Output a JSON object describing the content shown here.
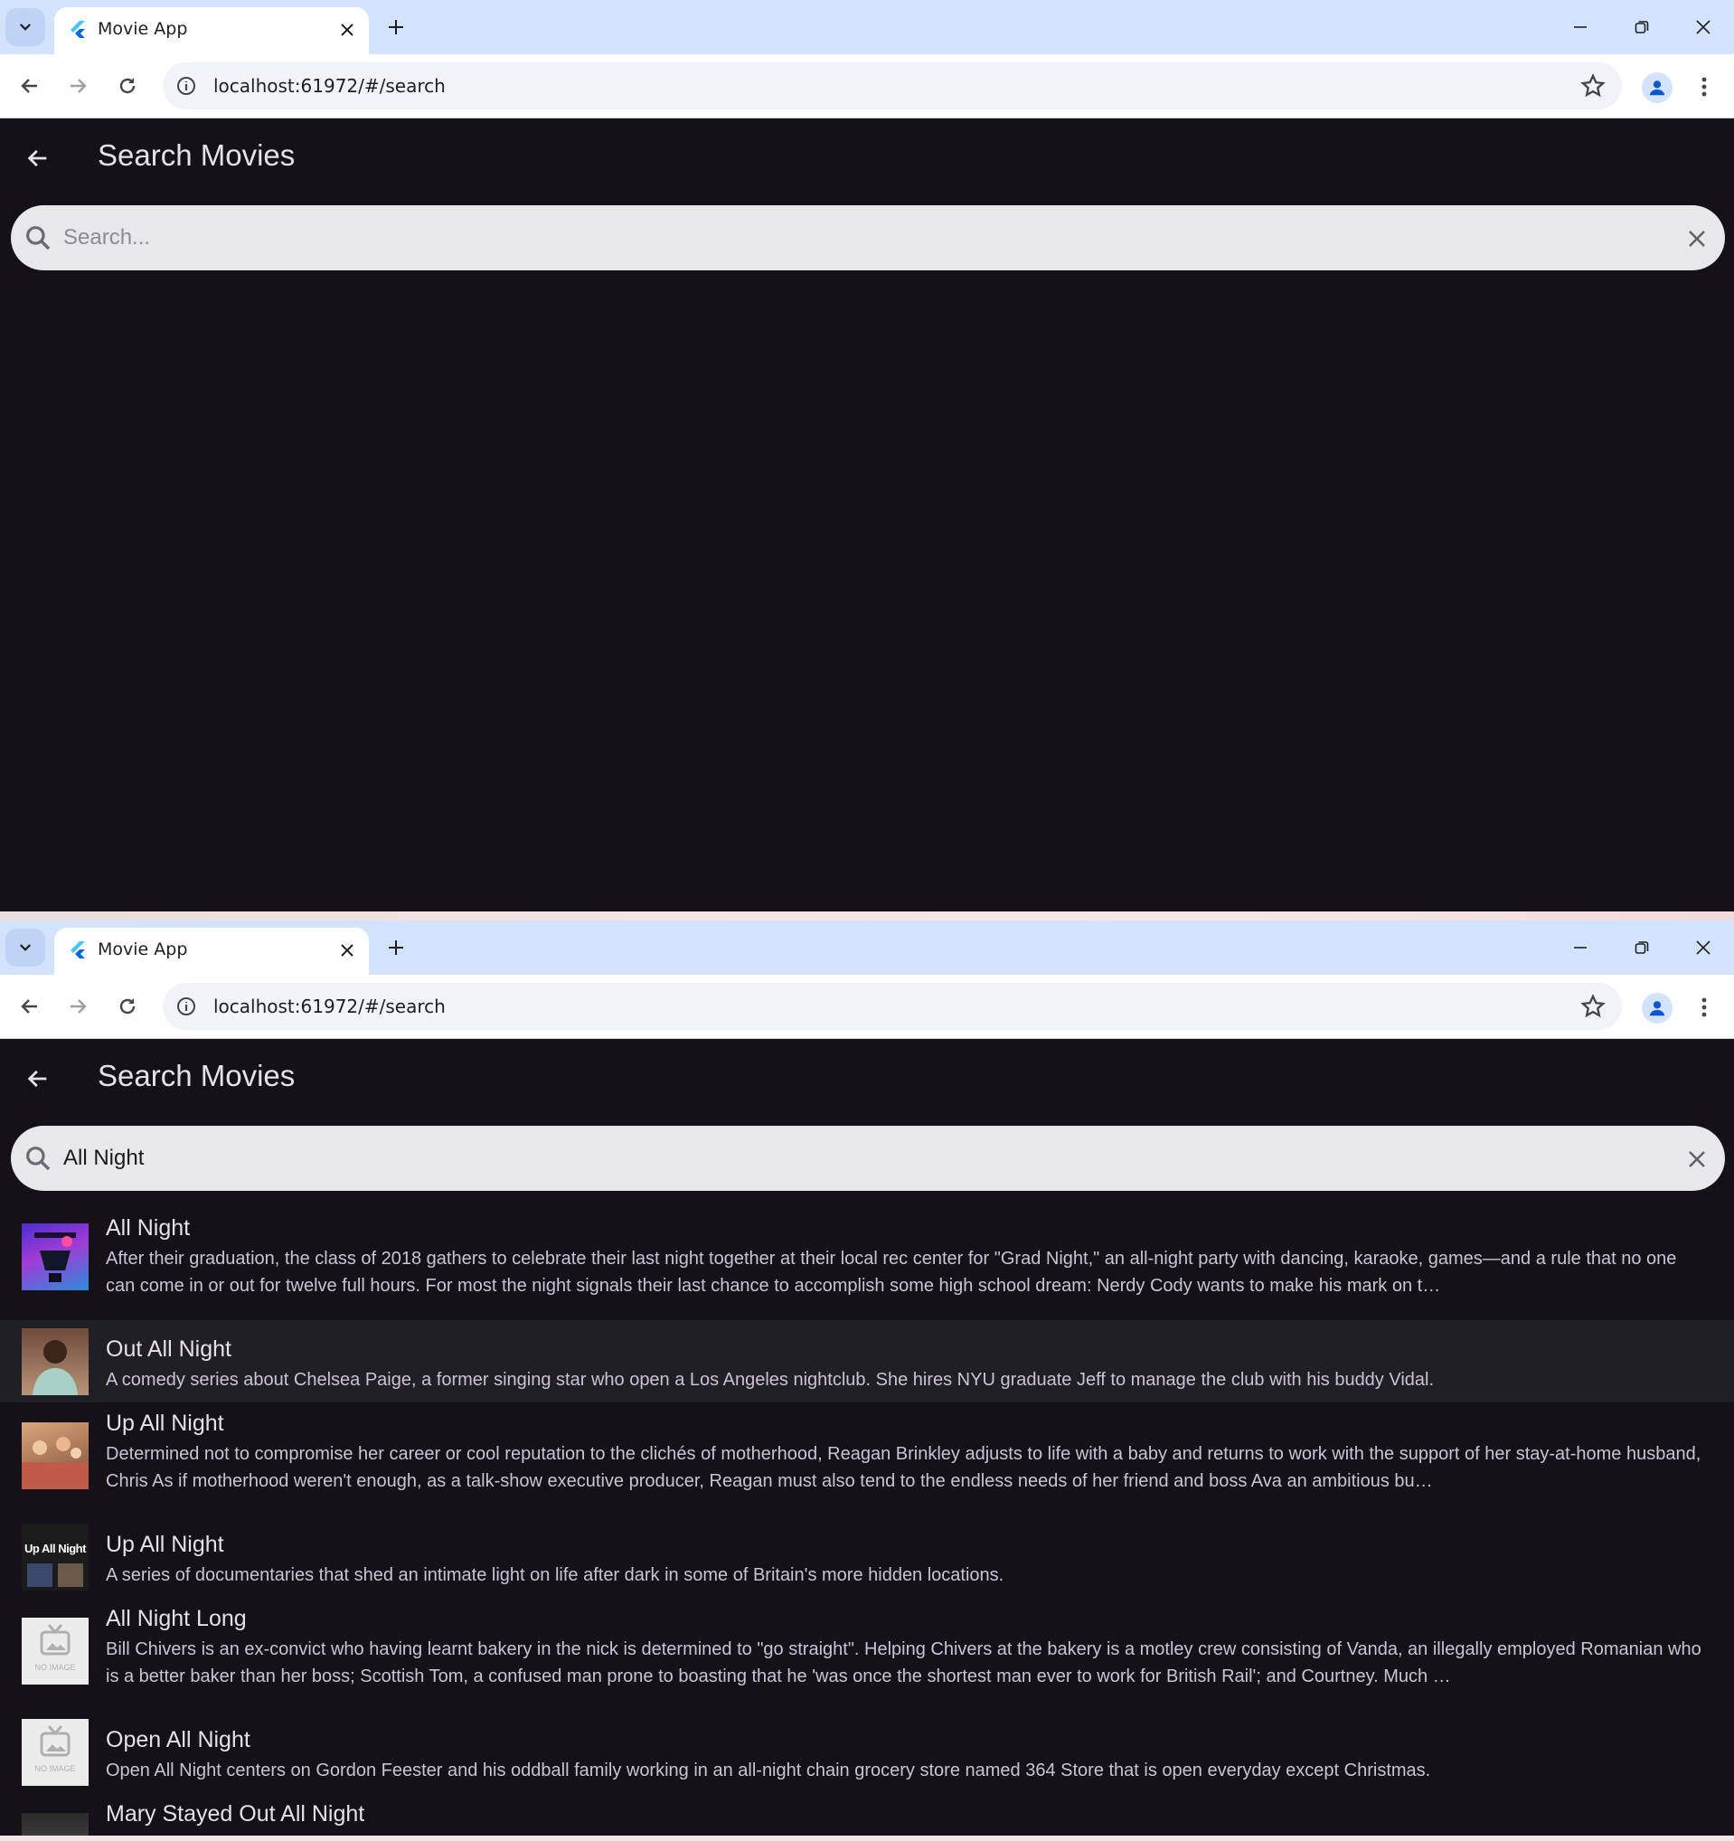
{
  "browser": {
    "tab_title": "Movie App",
    "url": "localhost:61972/#/search"
  },
  "app": {
    "title": "Search Movies",
    "search_placeholder": "Search...",
    "search_query": "All Night"
  },
  "results": [
    {
      "title": "All Night",
      "description": "After their graduation, the class of 2018 gathers to celebrate their last night together at their local rec center for \"Grad Night,\" an all-night party with dancing, karaoke, games—and a rule that no one can come in or out for twelve full hours. For most the night signals their last chance to accomplish some high school dream: Nerdy Cody wants to make his mark on t…"
    },
    {
      "title": "Out All Night",
      "description": "A comedy series about Chelsea Paige, a former singing star who open a Los Angeles nightclub. She hires NYU graduate Jeff to manage the club with his buddy Vidal."
    },
    {
      "title": "Up All Night",
      "description": "Determined not to compromise her career or cool reputation to the clichés of motherhood, Reagan Brinkley adjusts to life with a baby and returns to work with the support of her stay-at-home husband, Chris As if motherhood weren't enough, as a talk-show executive producer, Reagan must also tend to the endless needs of her friend and boss Ava an ambitious bu…"
    },
    {
      "title": "Up All Night",
      "description": "A series of documentaries that shed an intimate light on life after dark in some of Britain's more hidden locations.",
      "poster_text": "Up All Night"
    },
    {
      "title": "All Night Long",
      "description": "Bill Chivers is an ex-convict who having learnt bakery in the nick is determined to \"go straight\". Helping Chivers at the bakery is a motley crew consisting of Vanda, an illegally employed Romanian who is a better baker than her boss; Scottish Tom, a confused man prone to boasting that he 'was once the shortest man ever to work for British Rail'; and Courtney. Much …",
      "poster_text": "NO IMAGE"
    },
    {
      "title": "Open All Night",
      "description": "Open All Night centers on Gordon Feester and his oddball family working in an all-night chain grocery store named 364 Store that is open everyday except Christmas.",
      "poster_text": "NO IMAGE"
    },
    {
      "title": "Mary Stayed Out All Night",
      "description": ""
    }
  ]
}
